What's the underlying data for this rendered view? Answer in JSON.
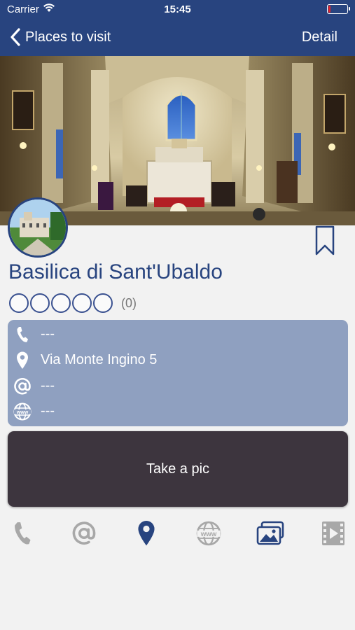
{
  "status_bar": {
    "carrier": "Carrier",
    "time": "15:45",
    "battery_level": 0.1,
    "battery_color": "#e5242b"
  },
  "nav": {
    "back_label": "Places to visit",
    "right_label": "Detail",
    "bar_color": "#28447f"
  },
  "place": {
    "title": "Basilica di Sant'Ubaldo",
    "rating": {
      "stars_filled": 0,
      "stars_total": 5,
      "count_label": "(0)"
    }
  },
  "info": {
    "card_color": "#8fa0c0",
    "rows": [
      {
        "icon": "phone-icon",
        "value": "---"
      },
      {
        "icon": "location-pin-icon",
        "value": "Via Monte Ingino 5"
      },
      {
        "icon": "at-sign-icon",
        "value": "---"
      },
      {
        "icon": "globe-www-icon",
        "value": "---"
      }
    ]
  },
  "actions": {
    "take_pic_label": "Take a pic",
    "button_color": "#3d353e"
  },
  "toolbar": {
    "items": [
      {
        "icon": "phone-icon",
        "active": false
      },
      {
        "icon": "at-sign-icon",
        "active": false
      },
      {
        "icon": "location-pin-icon",
        "active": true
      },
      {
        "icon": "globe-www-icon",
        "active": false
      },
      {
        "icon": "photo-gallery-icon",
        "active": true
      },
      {
        "icon": "video-icon",
        "active": false
      }
    ],
    "active_color": "#28447f",
    "inactive_color": "#a8a8a8"
  }
}
